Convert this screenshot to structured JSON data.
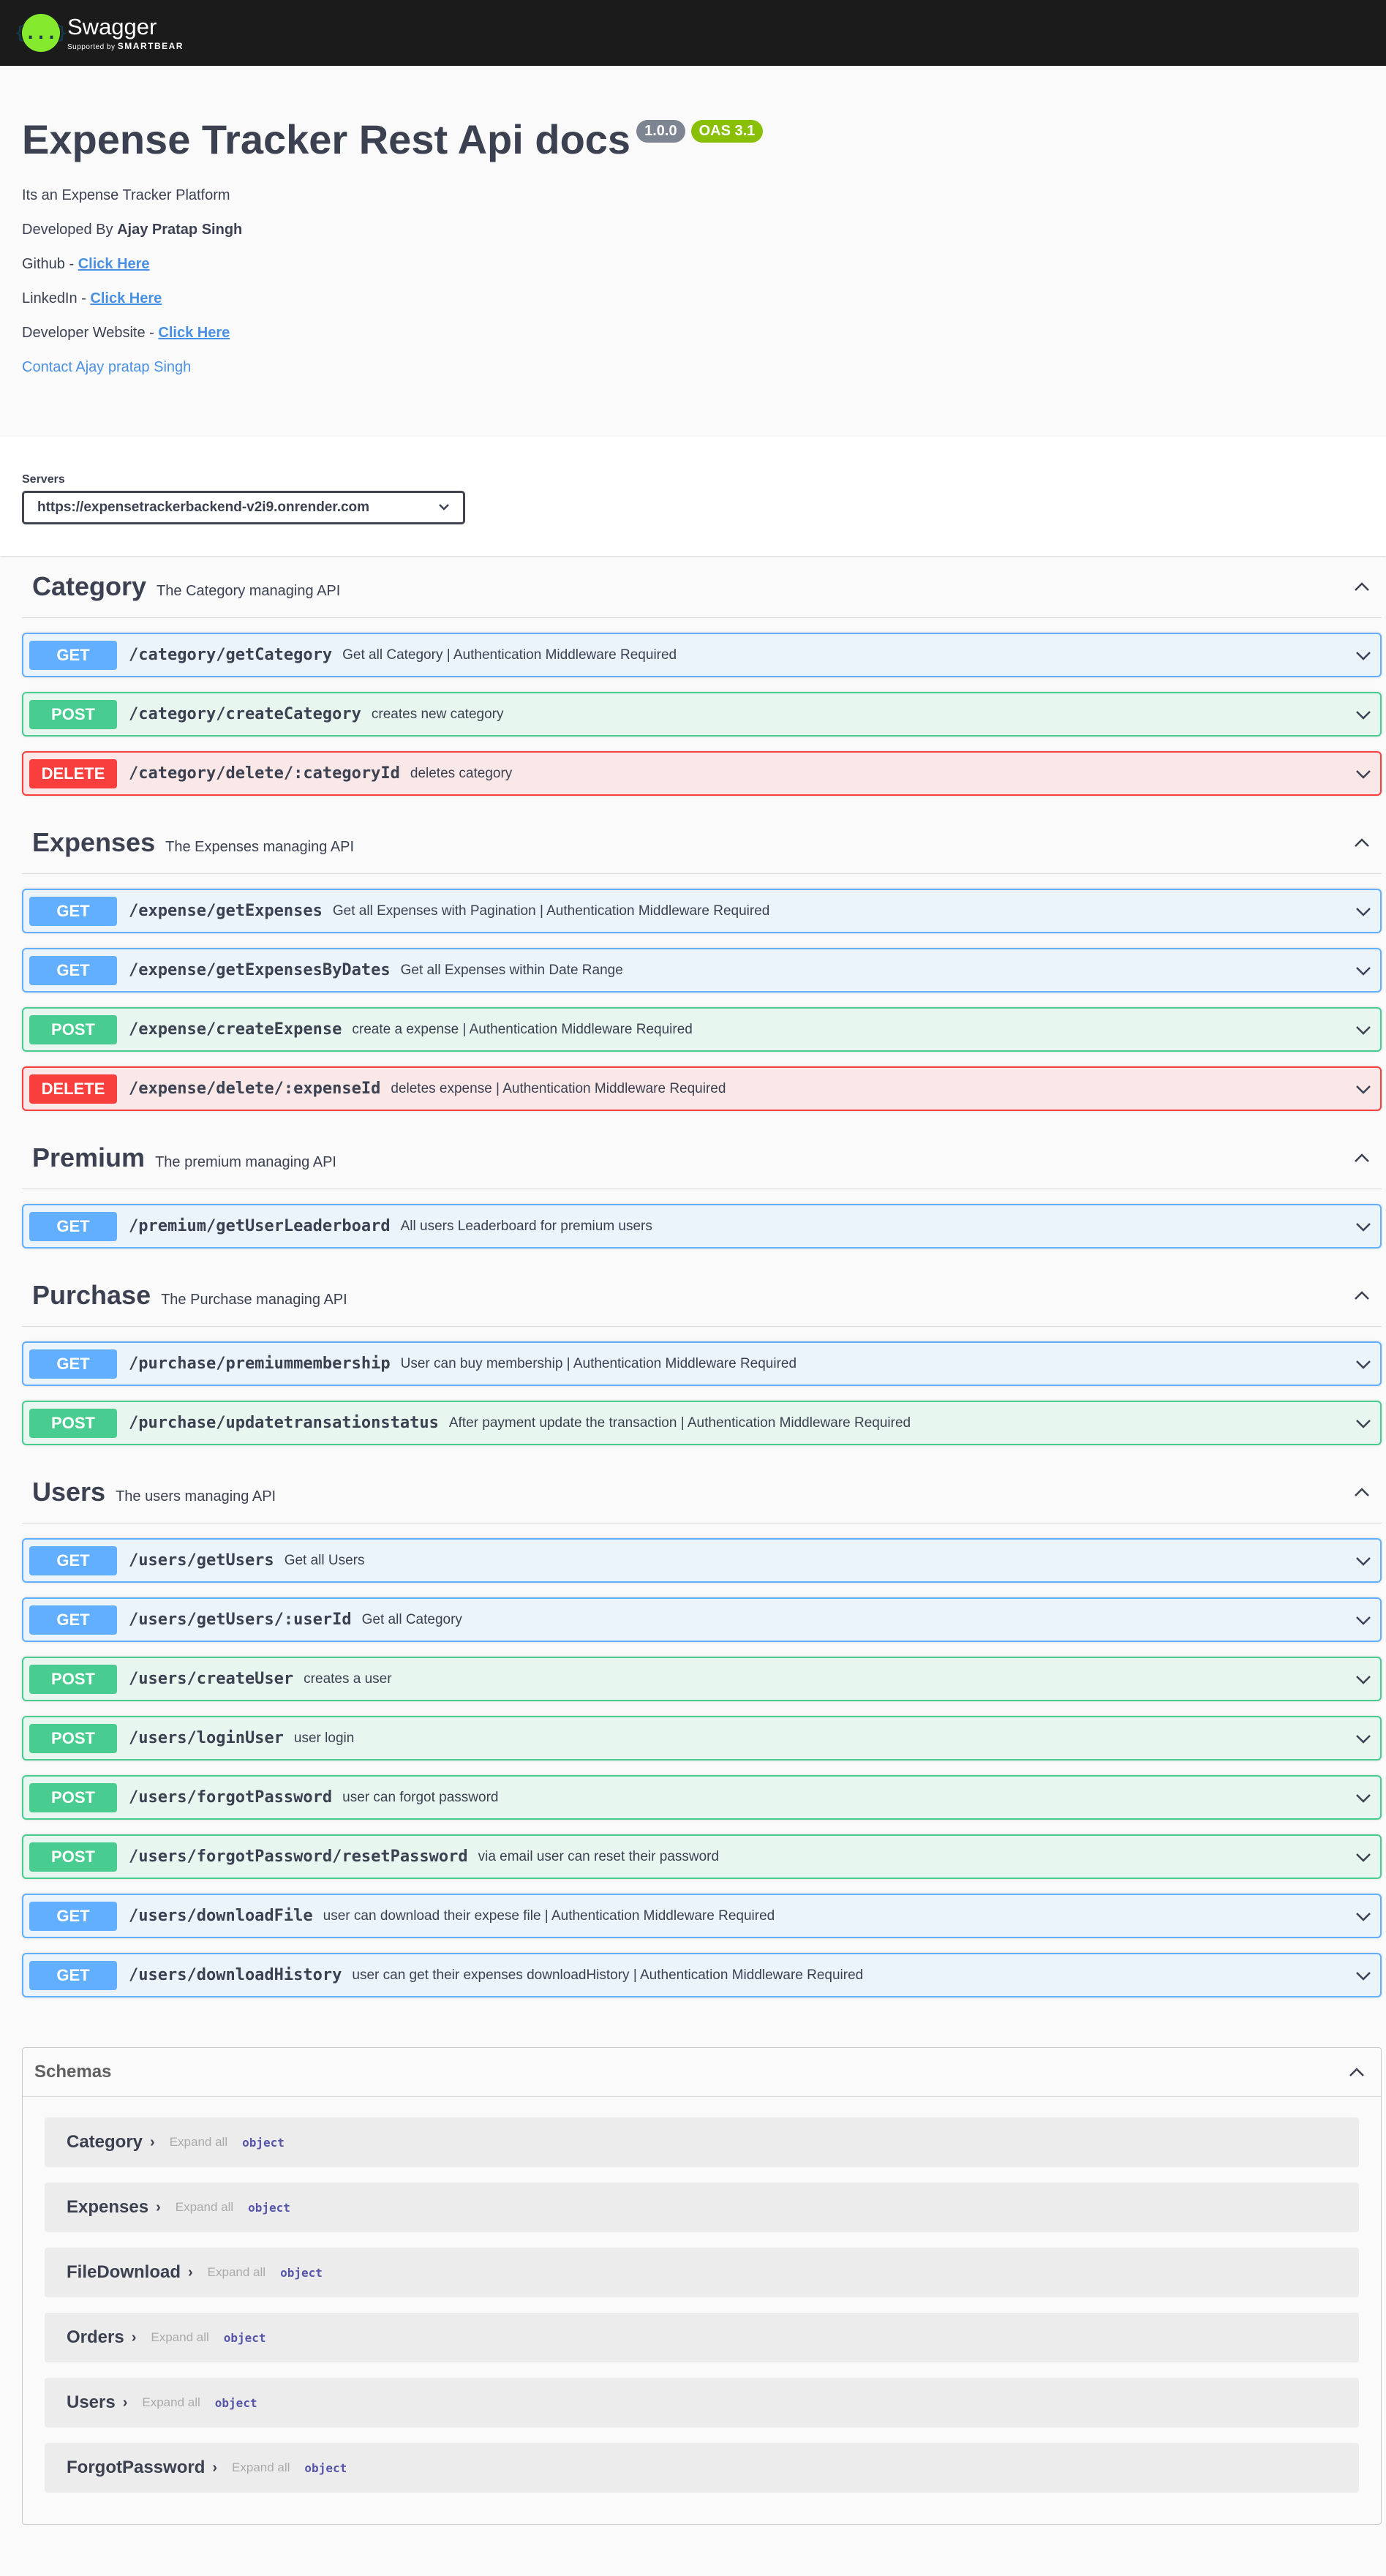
{
  "topbar": {
    "brand": "Swagger",
    "supported_by": "Supported by",
    "company": "SMARTBEAR",
    "logo_glyph": "{...}",
    "accent": "#85ea2d"
  },
  "info": {
    "title": "Expense Tracker Rest Api docs",
    "version": "1.0.0",
    "oas": "OAS 3.1",
    "description": "Its an Expense Tracker Platform",
    "developed_by_label": "Developed By",
    "developer_name": "Ajay Pratap Singh",
    "github_label": "Github -",
    "linkedin_label": "LinkedIn -",
    "website_label": "Developer Website -",
    "link_text": "Click Here",
    "contact": "Contact Ajay pratap Singh"
  },
  "servers": {
    "label": "Servers",
    "selected": "https://expensetrackerbackend-v2i9.onrender.com"
  },
  "sections": [
    {
      "name": "Category",
      "description": "The Category managing API",
      "ops": [
        {
          "method": "GET",
          "path": "/category/getCategory",
          "summary": "Get all Category | Authentication Middleware Required"
        },
        {
          "method": "POST",
          "path": "/category/createCategory",
          "summary": "creates new category"
        },
        {
          "method": "DELETE",
          "path": "/category/delete/:categoryId",
          "summary": "deletes category"
        }
      ]
    },
    {
      "name": "Expenses",
      "description": "The Expenses managing API",
      "ops": [
        {
          "method": "GET",
          "path": "/expense/getExpenses",
          "summary": "Get all Expenses with Pagination | Authentication Middleware Required"
        },
        {
          "method": "GET",
          "path": "/expense/getExpensesByDates",
          "summary": "Get all Expenses within Date Range"
        },
        {
          "method": "POST",
          "path": "/expense/createExpense",
          "summary": "create a expense | Authentication Middleware Required"
        },
        {
          "method": "DELETE",
          "path": "/expense/delete/:expenseId",
          "summary": "deletes expense | Authentication Middleware Required"
        }
      ]
    },
    {
      "name": "Premium",
      "description": "The premium managing API",
      "ops": [
        {
          "method": "GET",
          "path": "/premium/getUserLeaderboard",
          "summary": "All users Leaderboard for premium users"
        }
      ]
    },
    {
      "name": "Purchase",
      "description": "The Purchase managing API",
      "ops": [
        {
          "method": "GET",
          "path": "/purchase/premiummembership",
          "summary": "User can buy membership | Authentication Middleware Required"
        },
        {
          "method": "POST",
          "path": "/purchase/updatetransationstatus",
          "summary": "After payment update the transaction | Authentication Middleware Required"
        }
      ]
    },
    {
      "name": "Users",
      "description": "The users managing API",
      "ops": [
        {
          "method": "GET",
          "path": "/users/getUsers",
          "summary": "Get all Users"
        },
        {
          "method": "GET",
          "path": "/users/getUsers/:userId",
          "summary": "Get all Category"
        },
        {
          "method": "POST",
          "path": "/users/createUser",
          "summary": "creates a user"
        },
        {
          "method": "POST",
          "path": "/users/loginUser",
          "summary": "user login"
        },
        {
          "method": "POST",
          "path": "/users/forgotPassword",
          "summary": "user can forgot password"
        },
        {
          "method": "POST",
          "path": "/users/forgotPassword/resetPassword",
          "summary": "via email user can reset their password"
        },
        {
          "method": "GET",
          "path": "/users/downloadFile",
          "summary": "user can download their expese file | Authentication Middleware Required"
        },
        {
          "method": "GET",
          "path": "/users/downloadHistory",
          "summary": "user can get their expenses downloadHistory | Authentication Middleware Required"
        }
      ]
    }
  ],
  "schemas": {
    "title": "Schemas",
    "expand_label": "Expand all",
    "type_label": "object",
    "models": [
      "Category",
      "Expenses",
      "FileDownload",
      "Orders",
      "Users",
      "ForgotPassword"
    ]
  },
  "colors": {
    "get": "#61affe",
    "post": "#49cc90",
    "delete": "#f93e3e"
  }
}
